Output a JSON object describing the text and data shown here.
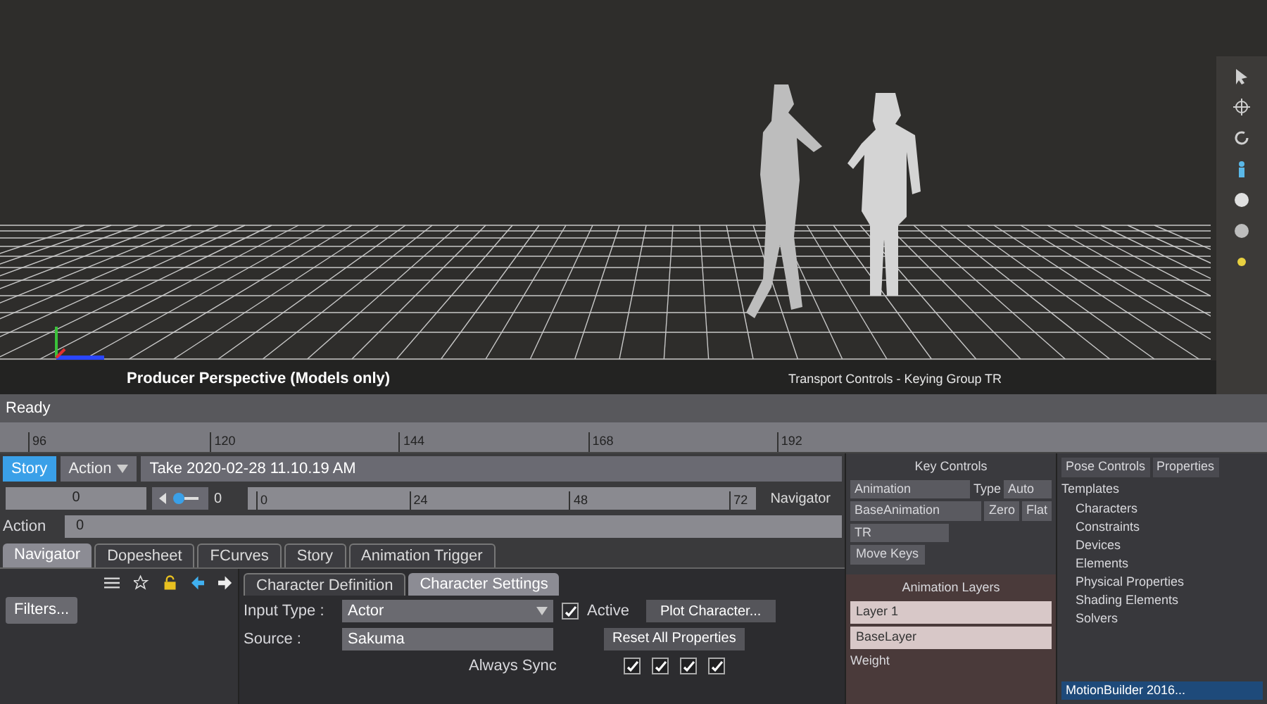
{
  "viewport": {
    "label": "Producer Perspective (Models only)",
    "overlay_label": "Transport Controls - Keying Group TR"
  },
  "status": "Ready",
  "timeline": {
    "ticks": [
      "96",
      "120",
      "144",
      "168",
      "192"
    ]
  },
  "story": {
    "modes": [
      {
        "label": "Story",
        "selected": true
      },
      {
        "label": "Action",
        "selected": false
      }
    ],
    "take": "Take 2020-02-28 11.10.19 AM",
    "start_field": "0",
    "nav_field": "0",
    "navigator_label": "Navigator",
    "ruler_ticks": [
      "0",
      "24",
      "48",
      "72"
    ],
    "action_label": "Action",
    "action_field": "0"
  },
  "tabs": [
    {
      "label": "Navigator",
      "selected": true
    },
    {
      "label": "Dopesheet",
      "selected": false
    },
    {
      "label": "FCurves",
      "selected": false
    },
    {
      "label": "Story",
      "selected": false
    },
    {
      "label": "Animation Trigger",
      "selected": false
    }
  ],
  "navigator": {
    "filters_button": "Filters..."
  },
  "character": {
    "tabs": [
      {
        "label": "Character Definition",
        "selected": false
      },
      {
        "label": "Character Settings",
        "selected": true
      }
    ],
    "active": {
      "label": "Active",
      "checked": true
    },
    "fields": [
      {
        "label": "Input Type :",
        "value": "Actor"
      },
      {
        "label": "Source :",
        "value": "Sakuma"
      }
    ],
    "buttons": [
      "Plot Character...",
      "Reset All Properties"
    ],
    "always_sync": {
      "label": "Always Sync",
      "checks": [
        {
          "checked": true
        },
        {
          "checked": true
        },
        {
          "checked": true
        },
        {
          "checked": true
        }
      ]
    }
  },
  "key_controls": {
    "title": "Key Controls",
    "layer_field": "Animation",
    "base_field": "BaseAnimation",
    "group_field": "TR",
    "type_label": "Type",
    "type_value": "Auto",
    "buttons": [
      "Zero",
      "Flat"
    ],
    "move_keys": "Move Keys"
  },
  "animation_layers": {
    "title": "Animation Layers",
    "layers": [
      {
        "name": "Layer 1",
        "selected": false
      },
      {
        "name": "BaseLayer",
        "selected": false
      }
    ],
    "weight_label": "Weight"
  },
  "resources": {
    "tabs": [
      {
        "label": "Pose Controls",
        "selected": false
      },
      {
        "label": "Properties",
        "selected": false
      }
    ],
    "root": "Templates",
    "items": [
      "Characters",
      "Constraints",
      "Devices",
      "Elements",
      "Physical Properties",
      "Shading Elements",
      "Solvers"
    ]
  },
  "taskbar": {
    "app": "MotionBuilder 2016..."
  }
}
